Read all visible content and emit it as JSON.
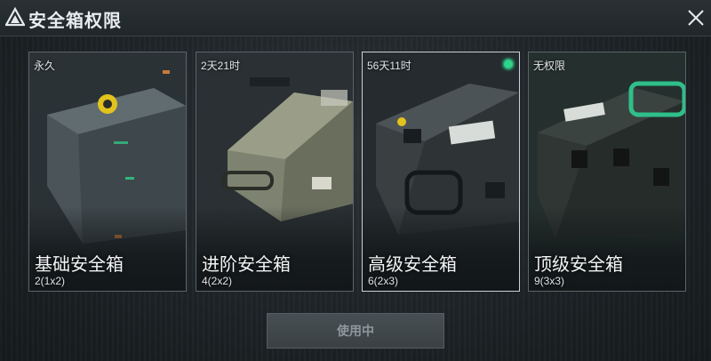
{
  "header": {
    "title": "安全箱权限"
  },
  "cards": [
    {
      "status": "永久",
      "name": "基础安全箱",
      "size": "2(1x2)"
    },
    {
      "status": "2天21时",
      "name": "进阶安全箱",
      "size": "4(2x2)"
    },
    {
      "status": "56天11时",
      "name": "高级安全箱",
      "size": "6(2x3)",
      "selected": true
    },
    {
      "status": "无权限",
      "name": "顶级安全箱",
      "size": "9(3x3)"
    }
  ],
  "footer": {
    "button_label": "使用中"
  },
  "colors": {
    "accent": "#2fd38a",
    "background": "#1d2326",
    "card_border": "#59646a",
    "selected_border": "#c9d2d6"
  },
  "icons": {
    "title": "triangle-logo-icon",
    "close": "close-icon",
    "active": "active-dot-icon"
  }
}
